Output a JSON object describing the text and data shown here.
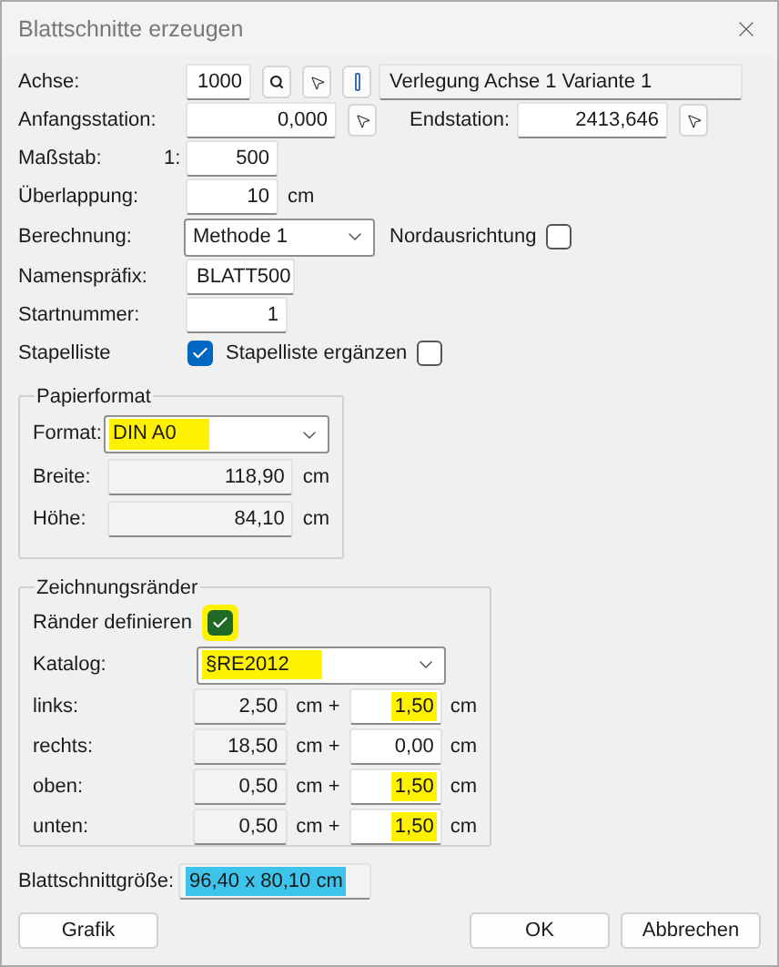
{
  "window": {
    "title": "Blattschnitte erzeugen"
  },
  "achse": {
    "label": "Achse:",
    "value": "1000",
    "description": "Verlegung Achse 1 Variante 1"
  },
  "anfangsstation": {
    "label": "Anfangsstation:",
    "value": "0,000"
  },
  "endstation": {
    "label": "Endstation:",
    "value": "2413,646"
  },
  "massstab": {
    "label": "Maßstab:",
    "prefix": "1:",
    "value": "500"
  },
  "ueberlappung": {
    "label": "Überlappung:",
    "value": "10",
    "unit": "cm"
  },
  "berechnung": {
    "label": "Berechnung:",
    "value": "Methode 1"
  },
  "nordausrichtung": {
    "label": "Nordausrichtung",
    "checked": false
  },
  "namenspraefix": {
    "label": "Namenspräfix:",
    "value": "BLATT500"
  },
  "startnummer": {
    "label": "Startnummer:",
    "value": "1"
  },
  "stapelliste": {
    "label": "Stapelliste",
    "checked": true
  },
  "stapelliste_ergaenzen": {
    "label": "Stapelliste ergänzen",
    "checked": false
  },
  "papierformat": {
    "title": "Papierformat",
    "format": {
      "label": "Format:",
      "value": "DIN A0",
      "color": "#fff200"
    },
    "breite": {
      "label": "Breite:",
      "value": "118,90",
      "unit": "cm"
    },
    "hoehe": {
      "label": "Höhe:",
      "value": "84,10",
      "unit": "cm"
    }
  },
  "zeichnungsraender": {
    "title": "Zeichnungsränder",
    "raender_definieren": {
      "label": "Ränder definieren",
      "checked": true,
      "color": "#fff200"
    },
    "katalog": {
      "label": "Katalog:",
      "value": "§RE2012",
      "color": "#fff200"
    },
    "rows": [
      {
        "label": "links:",
        "base": "2,50",
        "base_unit": "cm +",
        "extra": "1,50",
        "extra_unit": "cm",
        "color": "#fff200"
      },
      {
        "label": "rechts:",
        "base": "18,50",
        "base_unit": "cm +",
        "extra": "0,00",
        "extra_unit": "cm"
      },
      {
        "label": "oben:",
        "base": "0,50",
        "base_unit": "cm +",
        "extra": "1,50",
        "extra_unit": "cm",
        "color": "#fff200"
      },
      {
        "label": "unten:",
        "base": "0,50",
        "base_unit": "cm +",
        "extra": "1,50",
        "extra_unit": "cm",
        "color": "#fff200"
      }
    ]
  },
  "blattschnittgroesse": {
    "label": "Blattschnittgröße:",
    "value": "96,40 x 80,10 cm",
    "color": "#3ec4ea"
  },
  "buttons": [
    {
      "label": "Grafik"
    },
    {
      "label": "OK"
    },
    {
      "label": "Abbrechen"
    }
  ]
}
